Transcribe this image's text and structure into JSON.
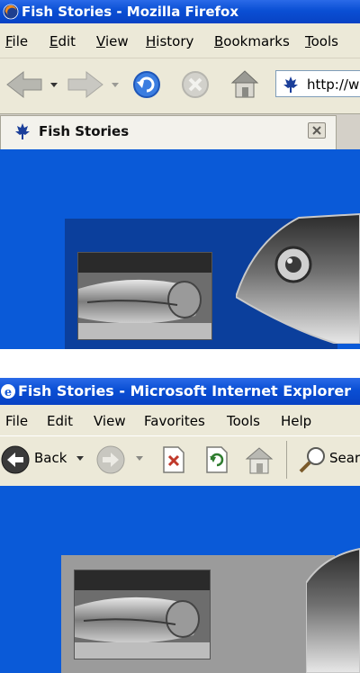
{
  "firefox": {
    "window_title": "Fish Stories - Mozilla Firefox",
    "menu": [
      "File",
      "Edit",
      "View",
      "History",
      "Bookmarks",
      "Tools"
    ],
    "address": "http://w",
    "tab_title": "Fish Stories"
  },
  "ie": {
    "window_title": "Fish Stories - Microsoft Internet Explorer",
    "menu": [
      "File",
      "Edit",
      "View",
      "Favorites",
      "Tools",
      "Help"
    ],
    "back_label": "Back",
    "search_label": "Sear"
  },
  "colors": {
    "page_background": "#0a5ad8",
    "ff_panel": "#0b3f9c",
    "ie_panel": "#9b9b9b",
    "titlebar": "#0a4fd4",
    "chrome": "#ece9d8"
  },
  "icons": [
    "firefox-app-icon",
    "back-arrow-icon",
    "forward-arrow-icon",
    "reload-icon",
    "stop-icon",
    "home-icon",
    "maple-leaf-icon",
    "tab-close-icon",
    "ie-app-icon",
    "ie-back-icon",
    "ie-forward-icon",
    "ie-stop-icon",
    "ie-refresh-icon",
    "ie-home-icon",
    "ie-search-icon"
  ]
}
